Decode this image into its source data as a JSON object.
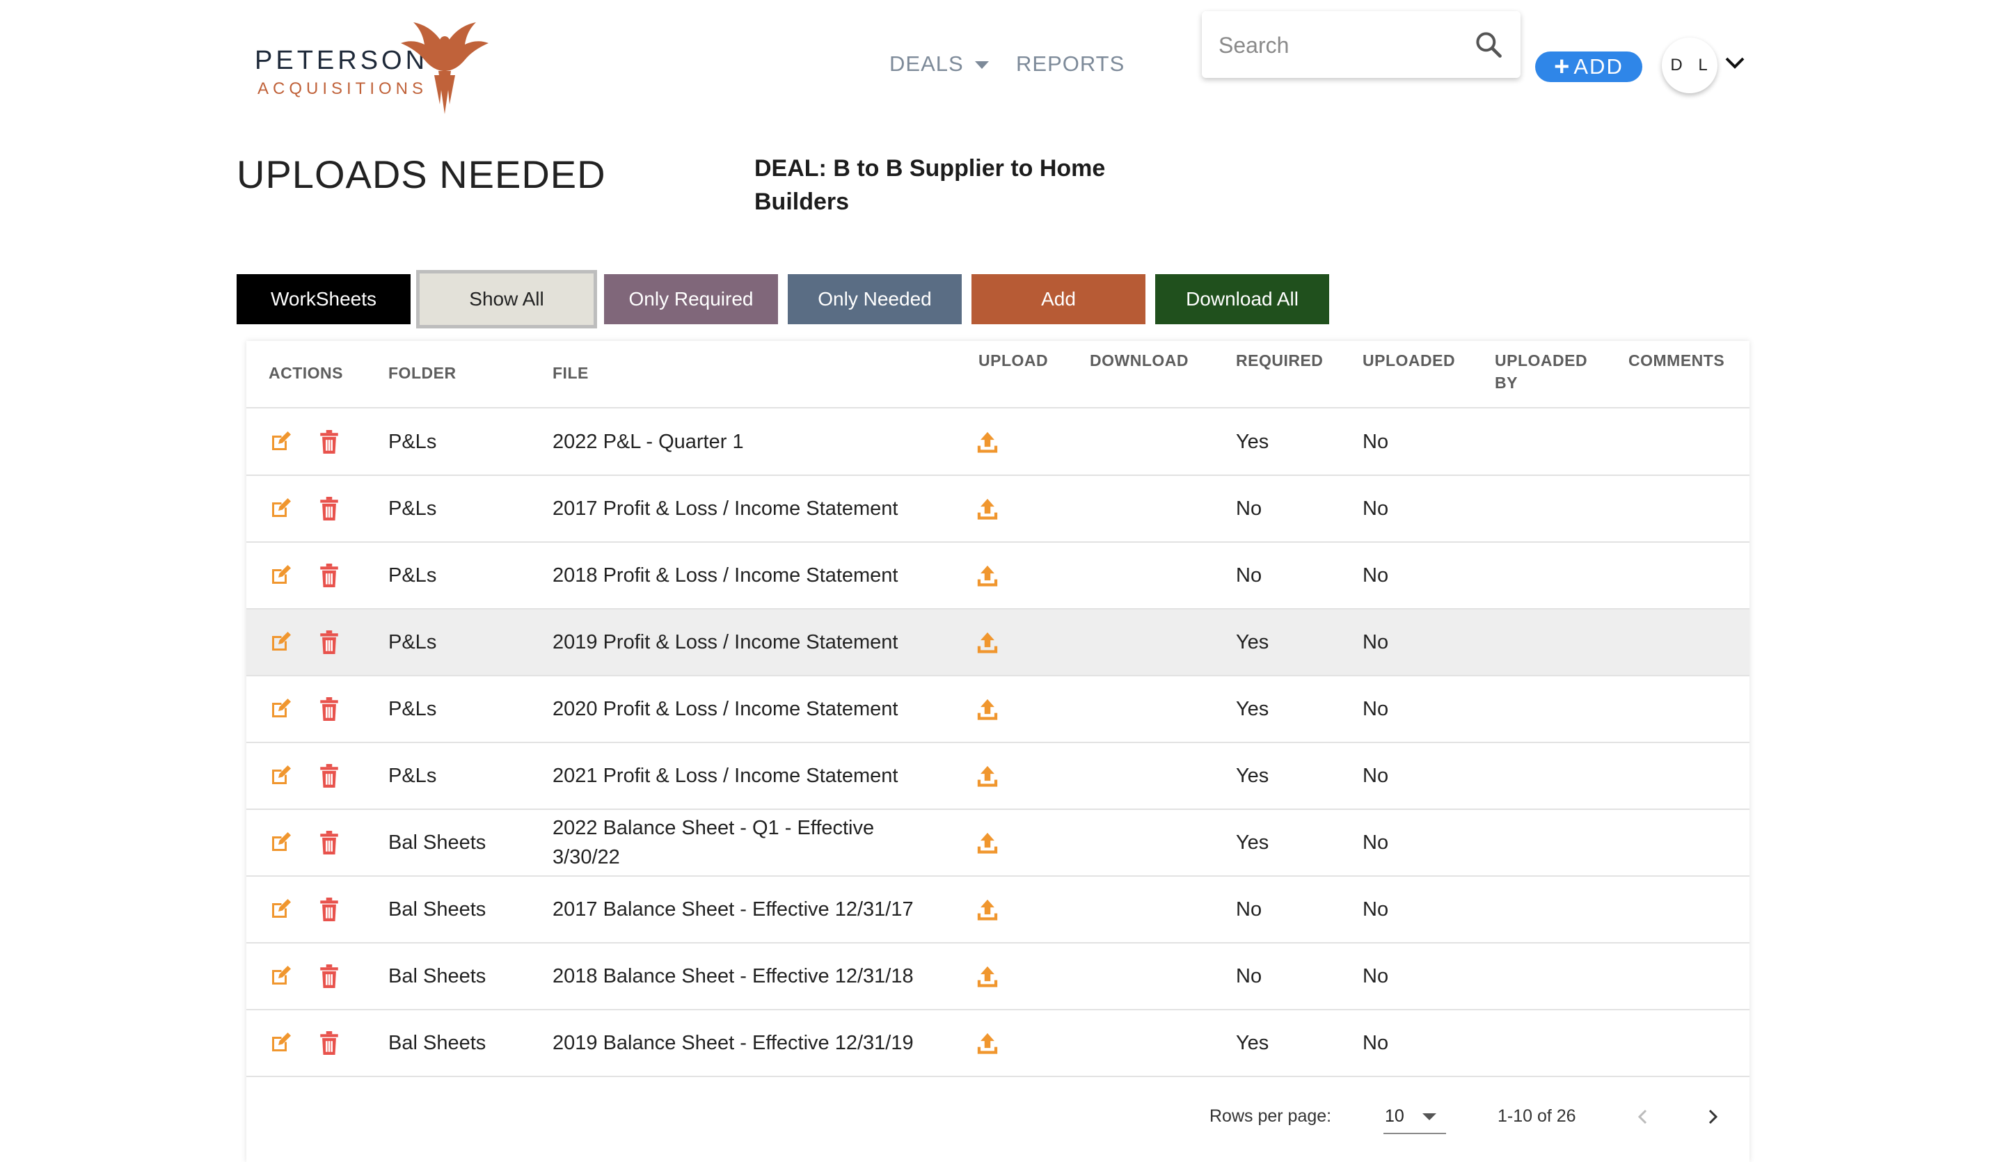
{
  "brand": {
    "name_line1": "PETERSON",
    "name_line2": "ACQUISITIONS",
    "accent": "#c0623a"
  },
  "nav": {
    "deals": "DEALS",
    "reports": "REPORTS"
  },
  "search": {
    "placeholder": "Search",
    "value": ""
  },
  "add_button": {
    "label": "ADD",
    "color": "#2f86e8"
  },
  "user": {
    "initials": "D L"
  },
  "page": {
    "title": "UPLOADS NEEDED",
    "deal": "DEAL: B to B Supplier to Home Builders"
  },
  "filters": {
    "worksheets": "WorkSheets",
    "show_all": "Show All",
    "only_required": "Only Required",
    "only_needed": "Only Needed",
    "add": "Add",
    "download_all": "Download All"
  },
  "table": {
    "columns": {
      "actions": "ACTIONS",
      "folder": "FOLDER",
      "file": "FILE",
      "upload": "UPLOAD",
      "download": "DOWNLOAD",
      "required": "REQUIRED",
      "uploaded": "UPLOADED",
      "uploaded_by_1": "UPLOADED",
      "uploaded_by_2": "BY",
      "comments": "COMMENTS"
    },
    "rows": [
      {
        "folder": "P&Ls",
        "file": "2022 P&L - Quarter 1",
        "required": "Yes",
        "uploaded": "No"
      },
      {
        "folder": "P&Ls",
        "file": "2017 Profit & Loss / Income Statement",
        "required": "No",
        "uploaded": "No"
      },
      {
        "folder": "P&Ls",
        "file": "2018 Profit & Loss / Income Statement",
        "required": "No",
        "uploaded": "No"
      },
      {
        "folder": "P&Ls",
        "file": "2019 Profit & Loss / Income Statement",
        "required": "Yes",
        "uploaded": "No"
      },
      {
        "folder": "P&Ls",
        "file": "2020 Profit & Loss / Income Statement",
        "required": "Yes",
        "uploaded": "No"
      },
      {
        "folder": "P&Ls",
        "file": "2021 Profit & Loss / Income Statement",
        "required": "Yes",
        "uploaded": "No"
      },
      {
        "folder": "Bal Sheets",
        "file": "2022 Balance Sheet - Q1 - Effective 3/30/22",
        "required": "Yes",
        "uploaded": "No"
      },
      {
        "folder": "Bal Sheets",
        "file": "2017 Balance Sheet - Effective 12/31/17",
        "required": "No",
        "uploaded": "No"
      },
      {
        "folder": "Bal Sheets",
        "file": "2018 Balance Sheet - Effective 12/31/18",
        "required": "No",
        "uploaded": "No"
      },
      {
        "folder": "Bal Sheets",
        "file": "2019 Balance Sheet - Effective 12/31/19",
        "required": "Yes",
        "uploaded": "No"
      }
    ]
  },
  "pagination": {
    "rows_per_page_label": "Rows per page:",
    "rows_per_page": "10",
    "range": "1-10 of 26"
  },
  "icon_colors": {
    "edit": "#f0962e",
    "delete": "#e8524c",
    "upload": "#f0962e"
  }
}
